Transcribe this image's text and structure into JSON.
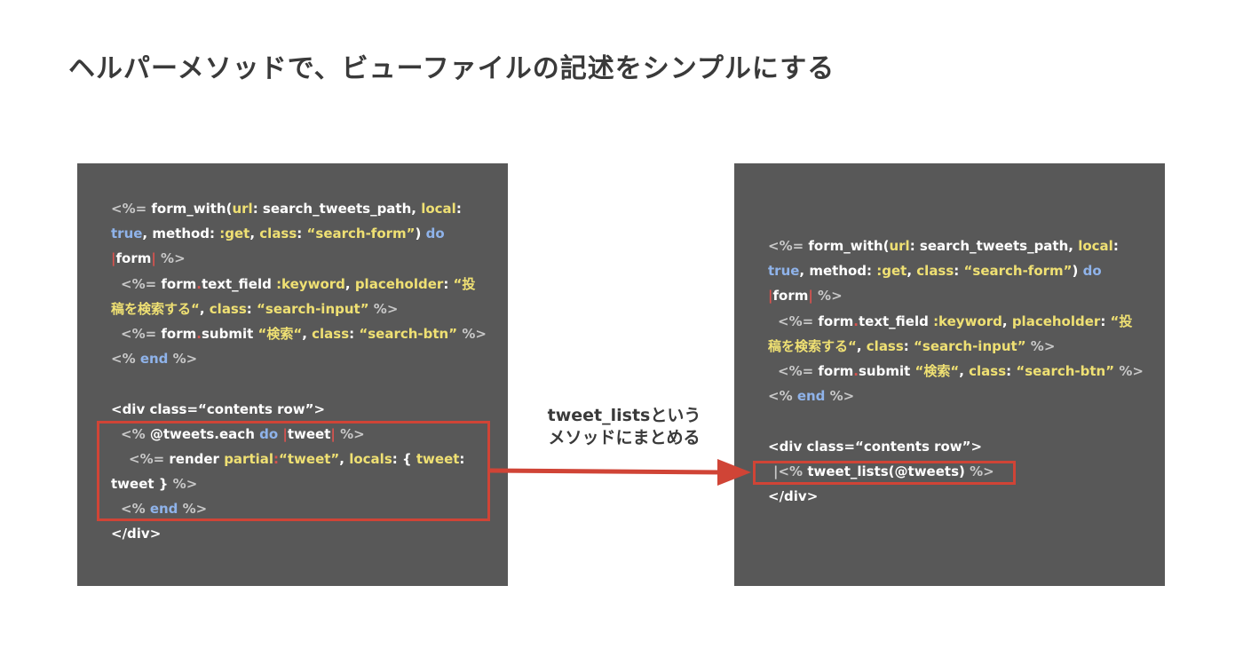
{
  "title": "ヘルパーメソッドで、ビューファイルの記述をシンプルにする",
  "left_code": {
    "l1": [
      "<%=",
      " form_with(",
      "url",
      ": search_tweets_path, ",
      "local",
      ":"
    ],
    "l2": [
      "true",
      ", method: ",
      ":get",
      ", ",
      "class",
      ": ",
      "“search-form”",
      ") ",
      "do"
    ],
    "l3": [
      "|",
      "form",
      "|",
      " %>"
    ],
    "l4": [
      "<%=",
      " form",
      ".",
      "text_field ",
      ":keyword",
      ", ",
      "placeholder",
      ": ",
      "“投"
    ],
    "l5": [
      "稿を検索する“",
      ", ",
      "class",
      ": ",
      "“search-input”",
      " %>"
    ],
    "l6": [
      "<%=",
      " form",
      ".",
      "submit ",
      "“検索“",
      ", ",
      "class",
      ": ",
      "“search-btn”",
      " %>"
    ],
    "l7": [
      "<%",
      " end",
      " %>"
    ],
    "l9": "<div class=“contents row”>",
    "l10": [
      "<%",
      " @tweets.each ",
      "do",
      " |",
      "tweet",
      "|",
      " %>"
    ],
    "l11": [
      "<%=",
      " render ",
      "partial",
      ": ",
      "“tweet”",
      ", ",
      "locals",
      ": { ",
      "tweet",
      ":"
    ],
    "l12": [
      "tweet } ",
      "%>"
    ],
    "l13": [
      "<%",
      " end",
      " %>"
    ],
    "l14": "</div>"
  },
  "right_code": {
    "l1": [
      "<%=",
      " form_with(",
      "url",
      ": search_tweets_path, ",
      "local",
      ":"
    ],
    "l2": [
      "true",
      ", method: ",
      ":get",
      ", ",
      "class",
      ": ",
      "“search-form”",
      ") ",
      "do"
    ],
    "l3": [
      "|",
      "form",
      "|",
      " %>"
    ],
    "l4": [
      "<%=",
      " form",
      ".",
      "text_field ",
      ":keyword",
      ", ",
      "placeholder",
      ": ",
      "“投"
    ],
    "l5": [
      "稿を検索する“",
      ", ",
      "class",
      ": ",
      "“search-input”",
      " %>"
    ],
    "l6": [
      "<%=",
      " form",
      ".",
      "submit ",
      "“検索“",
      ", ",
      "class",
      ": ",
      "“search-btn”",
      " %>"
    ],
    "l7": [
      "<%",
      " end",
      " %>"
    ],
    "l9": "<div class=“contents row”>",
    "l10": [
      "|",
      "<%",
      " tweet_lists(@tweets) ",
      "%>"
    ],
    "l11": "</div>"
  },
  "arrow_label": {
    "line1": "tweet_listsという",
    "line2": "メソッドにまとめる"
  },
  "colors": {
    "panel": "#585858",
    "keyword_yellow": "#efe073",
    "keyword_blue": "#8fb3ea",
    "erb_tag_gray": "#c8c8c8",
    "highlight_red": "#d04436"
  }
}
